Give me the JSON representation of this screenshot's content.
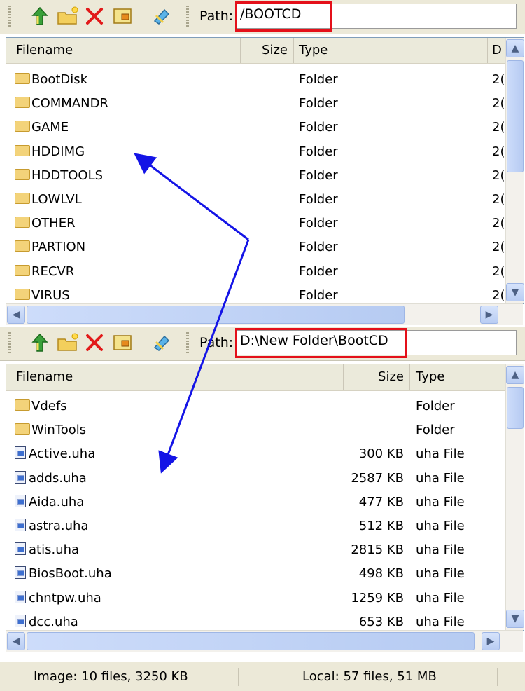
{
  "top": {
    "path_label": "Path:",
    "path_value": "/BOOTCD",
    "columns": [
      "Filename",
      "Size",
      "Type",
      "D"
    ],
    "rows": [
      {
        "name": "BootDisk",
        "size": "",
        "type": "Folder",
        "date": "2("
      },
      {
        "name": "COMMANDR",
        "size": "",
        "type": "Folder",
        "date": "2("
      },
      {
        "name": "GAME",
        "size": "",
        "type": "Folder",
        "date": "2("
      },
      {
        "name": "HDDIMG",
        "size": "",
        "type": "Folder",
        "date": "2("
      },
      {
        "name": "HDDTOOLS",
        "size": "",
        "type": "Folder",
        "date": "2("
      },
      {
        "name": "LOWLVL",
        "size": "",
        "type": "Folder",
        "date": "2("
      },
      {
        "name": "OTHER",
        "size": "",
        "type": "Folder",
        "date": "2("
      },
      {
        "name": "PARTION",
        "size": "",
        "type": "Folder",
        "date": "2("
      },
      {
        "name": "RECVR",
        "size": "",
        "type": "Folder",
        "date": "2("
      },
      {
        "name": "VIRUS",
        "size": "",
        "type": "Folder",
        "date": "2("
      }
    ]
  },
  "bottom": {
    "path_label": "Path:",
    "path_value": "D:\\New Folder\\BootCD",
    "columns": [
      "Filename",
      "Size",
      "Type"
    ],
    "rows": [
      {
        "name": "Vdefs",
        "size": "",
        "type": "Folder",
        "icon": "folder"
      },
      {
        "name": "WinTools",
        "size": "",
        "type": "Folder",
        "icon": "folder"
      },
      {
        "name": "Active.uha",
        "size": "300 KB",
        "type": "uha File",
        "icon": "file"
      },
      {
        "name": "adds.uha",
        "size": "2587 KB",
        "type": "uha File",
        "icon": "file"
      },
      {
        "name": "Aida.uha",
        "size": "477 KB",
        "type": "uha File",
        "icon": "file"
      },
      {
        "name": "astra.uha",
        "size": "512 KB",
        "type": "uha File",
        "icon": "file"
      },
      {
        "name": "atis.uha",
        "size": "2815 KB",
        "type": "uha File",
        "icon": "file"
      },
      {
        "name": "BiosBoot.uha",
        "size": "498 KB",
        "type": "uha File",
        "icon": "file"
      },
      {
        "name": "chntpw.uha",
        "size": "1259 KB",
        "type": "uha File",
        "icon": "file"
      },
      {
        "name": "dcc.uha",
        "size": "653 KB",
        "type": "uha File",
        "icon": "file"
      }
    ]
  },
  "status": {
    "image": "Image: 10 files, 3250 KB",
    "local": "Local: 57 files, 51 MB"
  },
  "toolbar_icons": [
    "up-folder-icon",
    "new-folder-icon",
    "delete-icon",
    "properties-icon",
    "refresh-icon"
  ],
  "colors": {
    "highlight": "#e4101a",
    "arrow": "#1414e6",
    "toolbar": "#ece9d8"
  }
}
